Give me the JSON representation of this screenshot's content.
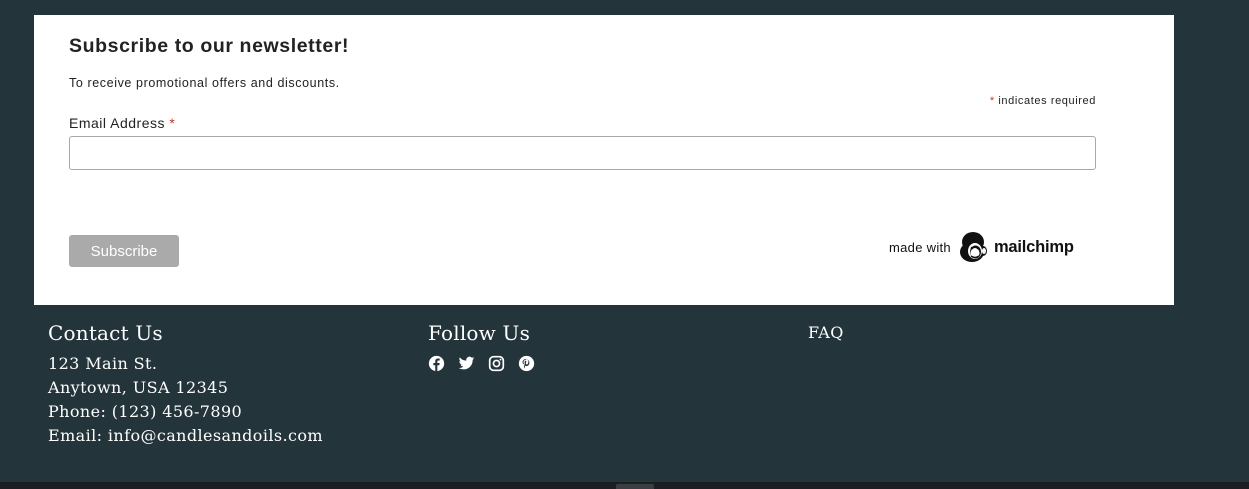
{
  "newsletter": {
    "title": "Subscribe to our newsletter!",
    "subtitle": "To receive promotional offers and discounts.",
    "required_marker": "*",
    "required_note": "indicates required",
    "email_label": "Email Address",
    "email_value": "",
    "email_placeholder": "",
    "subscribe_label": "Subscribe",
    "made_with": "made with",
    "brand": "mailchimp"
  },
  "footer": {
    "contact": {
      "heading": "Contact Us",
      "lines": [
        "123 Main St.",
        "Anytown, USA 12345",
        "Phone: (123) 456-7890",
        "Email: info@candlesandoils.com"
      ]
    },
    "follow": {
      "heading": "Follow Us",
      "icons": [
        "facebook-icon",
        "twitter-icon",
        "instagram-icon",
        "pinterest-icon"
      ]
    },
    "faq": {
      "label": "FAQ"
    }
  },
  "colors": {
    "background": "#23343a",
    "card": "#ffffff",
    "button": "#aaaaaa",
    "required": "#c0392b"
  }
}
